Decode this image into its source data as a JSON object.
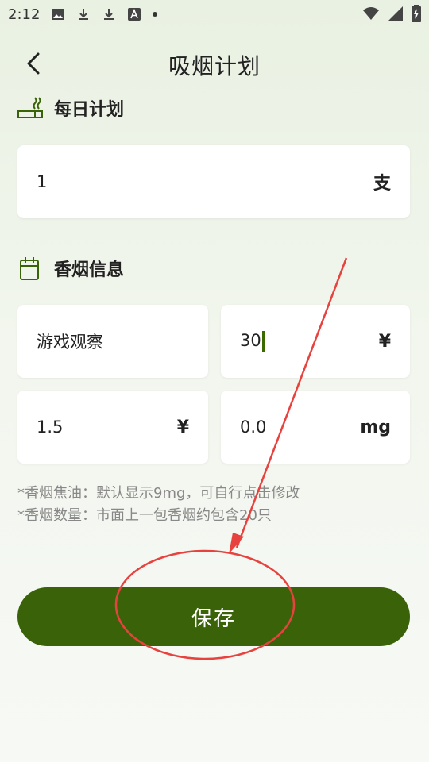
{
  "status_bar": {
    "time": "2:12"
  },
  "header": {
    "title": "吸烟计划"
  },
  "daily_plan": {
    "title": "每日计划",
    "value": "1",
    "unit": "支"
  },
  "cigarette_info": {
    "title": "香烟信息",
    "brand": "游戏观察",
    "price": "30",
    "price_unit": "¥",
    "per_unit_price": "1.5",
    "per_unit_price_unit": "¥",
    "tar": "0.0",
    "tar_unit": "mg"
  },
  "notes": {
    "line1": "*香烟焦油：默认显示9mg，可自行点击修改",
    "line2": "*香烟数量：市面上一包香烟约包含20只"
  },
  "save_label": "保存",
  "colors": {
    "accent": "#3a6309",
    "annotation": "#e8423f"
  }
}
